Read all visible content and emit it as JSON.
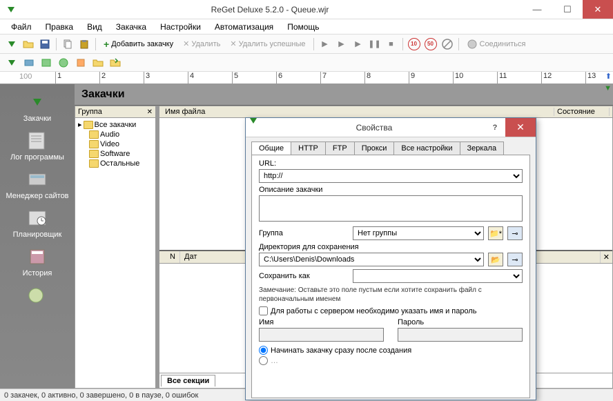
{
  "window": {
    "title": "ReGet Deluxe 5.2.0 - Queue.wjr"
  },
  "menu": [
    "Файл",
    "Правка",
    "Вид",
    "Закачка",
    "Настройки",
    "Автоматизация",
    "Помощь"
  ],
  "toolbar": {
    "add": "Добавить закачку",
    "del": "Удалить",
    "del_ok": "Удалить успешные",
    "connect": "Соединиться",
    "speed1": "10",
    "speed2": "50"
  },
  "ruler": {
    "start": "100",
    "ticks": [
      "1",
      "2",
      "3",
      "4",
      "5",
      "6",
      "7",
      "8",
      "9",
      "10",
      "11",
      "12",
      "13"
    ]
  },
  "sidebar": [
    "Закачки",
    "Лог программы",
    "Менеджер сайтов",
    "Планировщик",
    "История",
    ""
  ],
  "content": {
    "heading": "Закачки",
    "group_head": "Группа",
    "file_head": "Имя файла",
    "state_head": "Состояние",
    "tree": {
      "root": "Все закачки",
      "items": [
        "Audio",
        "Video",
        "Software",
        "Остальные"
      ]
    },
    "lower_cols": [
      "N",
      "Дат"
    ],
    "lower_tab": "Все секции"
  },
  "dialog": {
    "title": "Свойства",
    "tabs": [
      "Общие",
      "HTTP",
      "FTP",
      "Прокси",
      "Все настройки",
      "Зеркала"
    ],
    "url_label": "URL:",
    "url_value": "http://",
    "desc_label": "Описание закачки",
    "group_label": "Группа",
    "group_value": "Нет группы",
    "dir_label": "Директория для сохранения",
    "dir_value": "C:\\Users\\Denis\\Downloads",
    "saveas_label": "Сохранить как",
    "note": "Замечание: Оставьте это поле пустым если хотите сохранить файл с первоначальным именем",
    "auth_check": "Для работы с сервером необходимо указать имя и пароль",
    "name_label": "Имя",
    "pass_label": "Пароль",
    "radio1": "Начинать закачку сразу после создания"
  },
  "status": "0 закачек, 0 активно, 0 завершено, 0 в паузе, 0 ошибок"
}
